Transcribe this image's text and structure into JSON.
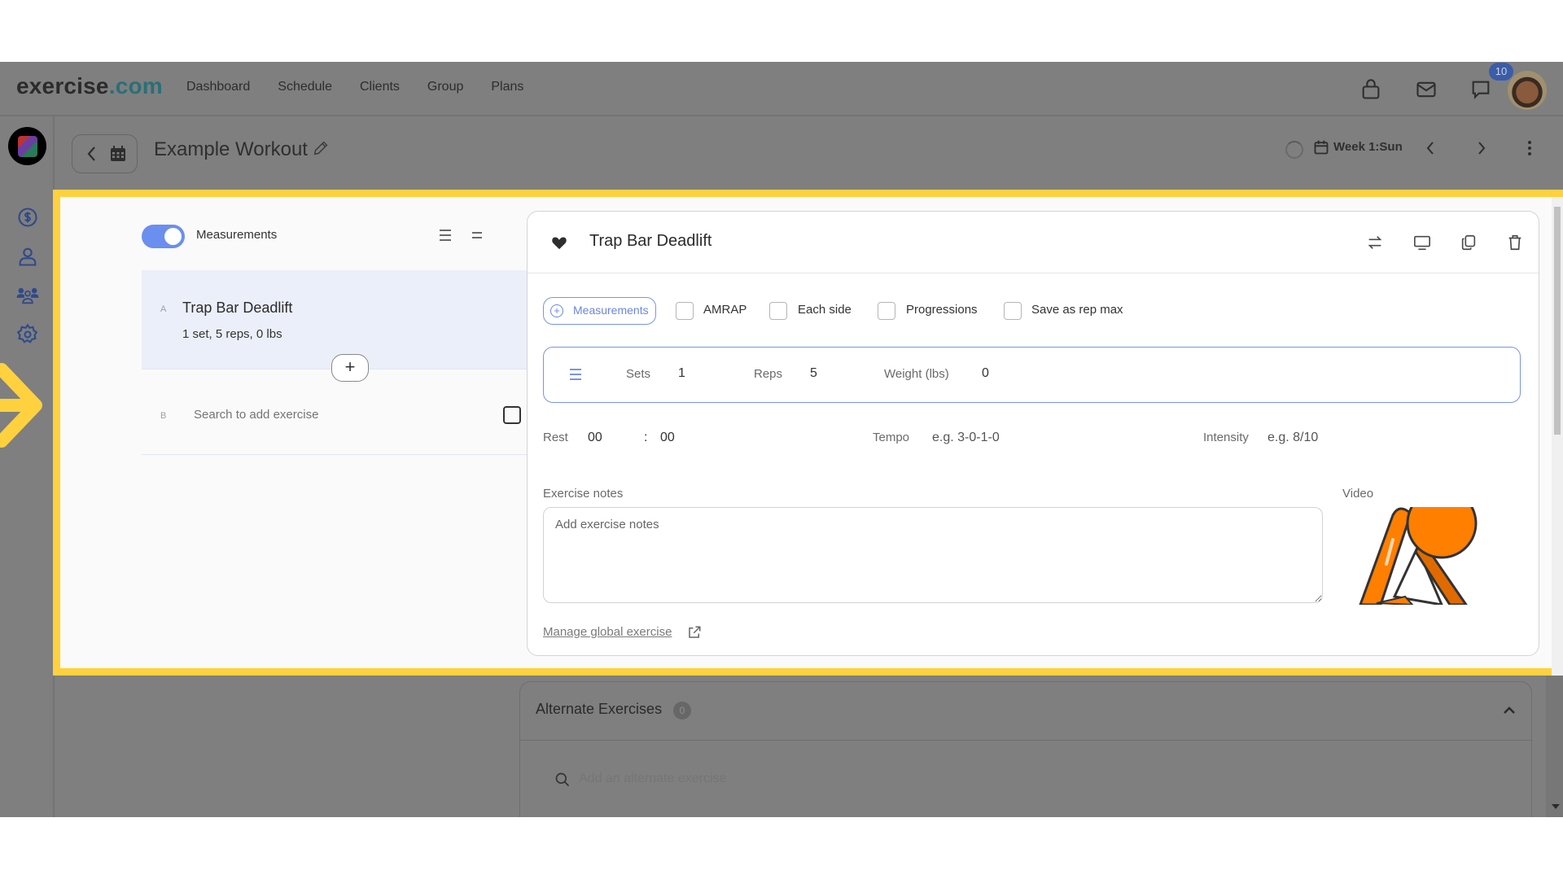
{
  "navbar": {
    "logo_main": "exercise",
    "logo_tld": ".com",
    "links": [
      "Dashboard",
      "Schedule",
      "Clients",
      "Group",
      "Plans"
    ],
    "icons": [
      "shopping-bag-icon",
      "mail-icon",
      "chat-icon"
    ],
    "notification_count": "10"
  },
  "rail": {
    "icons": [
      "billing-icon",
      "user-icon",
      "group-icon",
      "settings-icon"
    ]
  },
  "toolbar": {
    "workout_title": "Example Workout",
    "week_label": "Week 1:Sun"
  },
  "left_panel": {
    "toggle_label": "Measurements",
    "toggle_on": true,
    "exercises": [
      {
        "letter": "A",
        "name": "Trap Bar Deadlift",
        "detail": "1 set, 5 reps, 0 lbs"
      }
    ],
    "add_row": {
      "letter": "B",
      "placeholder": "Search to add exercise"
    },
    "add_between_label": "+"
  },
  "card": {
    "title": "Trap Bar Deadlift",
    "header_icons": [
      "swap-icon",
      "monitor-icon",
      "copy-icon",
      "trash-icon"
    ],
    "measurements_button": "Measurements",
    "options": [
      {
        "label": "AMRAP",
        "checked": false
      },
      {
        "label": "Each side",
        "checked": false
      },
      {
        "label": "Progressions",
        "checked": false
      },
      {
        "label": "Save as rep max",
        "checked": false
      }
    ],
    "sets": {
      "sets_label": "Sets",
      "sets_value": "1",
      "reps_label": "Reps",
      "reps_value": "5",
      "weight_label": "Weight (lbs)",
      "weight_value": "0"
    },
    "rest": {
      "label": "Rest",
      "minutes": "00",
      "separator": ":",
      "seconds": "00"
    },
    "tempo": {
      "label": "Tempo",
      "placeholder": "e.g. 3-0-1-0"
    },
    "intensity": {
      "label": "Intensity",
      "placeholder": "e.g. 8/10"
    },
    "notes_label": "Exercise notes",
    "notes_placeholder": "Add exercise notes",
    "video_label": "Video",
    "manage_link": "Manage global exercise"
  },
  "alternate": {
    "title": "Alternate Exercises",
    "count": "0",
    "search_placeholder": "Add an alternate exercise"
  },
  "colors": {
    "highlight": "#ffd13f",
    "accent": "#6b8fef",
    "brand_tld": "#2a6f78",
    "overlay_gray": "#7f7f7f"
  }
}
